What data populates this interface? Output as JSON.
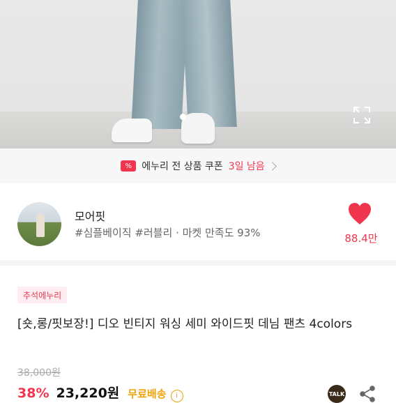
{
  "coupon": {
    "text": "에누리 전 상품 쿠폰",
    "days": "3일 남음",
    "icon": "%"
  },
  "seller": {
    "name": "모어핏",
    "tags": "#심플베이직 #러블리 · 마켓 만족도 93%",
    "likes": "88.4만"
  },
  "product": {
    "badge": "추석에누리",
    "title": "[숏,롱/핏보장!] 디오 빈티지 워싱 세미 와이드핏 데님 팬츠 4colors",
    "original_price": "38,000원",
    "discount": "38%",
    "price": "23,220원",
    "shipping": "무료배송",
    "talk_label": "TALK"
  },
  "colors": {
    "accent": "#f0364e",
    "shipping": "#f0a30a"
  }
}
